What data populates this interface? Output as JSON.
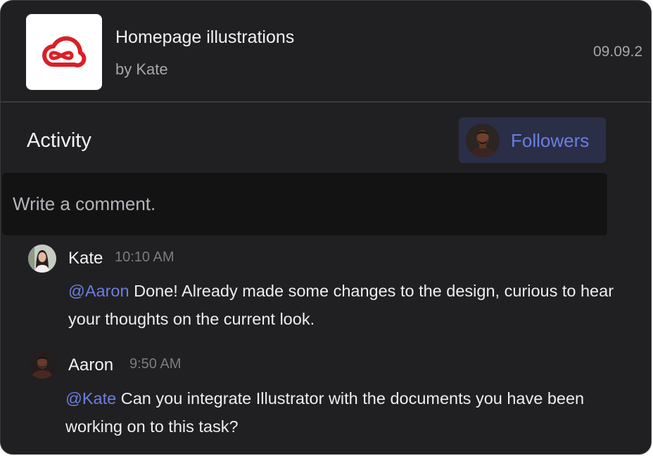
{
  "project": {
    "app_icon": "creative-cloud-icon",
    "title": "Homepage illustrations",
    "author": "by Kate",
    "date": "09.09.2"
  },
  "activity": {
    "title": "Activity",
    "followers_label": "Followers",
    "comment_placeholder": "Write a comment."
  },
  "comments": [
    {
      "author": "Kate",
      "time": "10:10 AM",
      "mention": "@Aaron",
      "text": " Done! Already made some changes to the design, curious to hear your thoughts on the current look."
    },
    {
      "author": "Aaron",
      "time": "9:50 AM",
      "mention": "@Kate",
      "text": " Can you integrate Illustrator with the documents you have been working on to this task?"
    }
  ],
  "colors": {
    "card_background": "#202022",
    "accent": "#6b7fe0",
    "followers_button_background": "#2a2e47",
    "input_background": "#131314",
    "brand_red": "#da1f26"
  }
}
